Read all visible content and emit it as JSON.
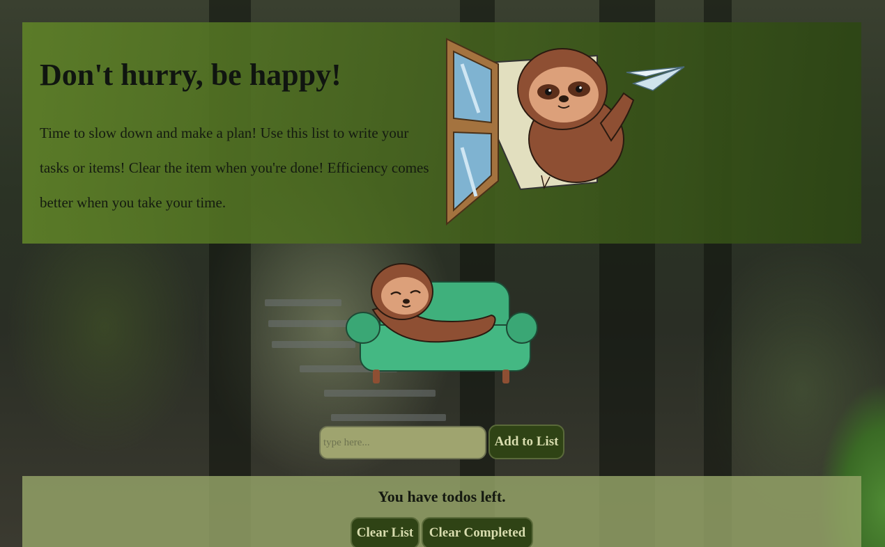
{
  "hero": {
    "title": "Don't hurry, be happy!",
    "description": "Time to slow down and make a plan! Use this list to write your tasks or items! Clear the item when you're done! Efficiency comes better when you take your time."
  },
  "todo_form": {
    "input_placeholder": "type here...",
    "input_value": "",
    "add_label": "Add to List"
  },
  "todo_list": {
    "count_text": "You have todos left.",
    "clear_list_label": "Clear List",
    "clear_completed_label": "Clear Completed"
  },
  "colors": {
    "hero_panel": "#5f8228",
    "list_panel": "#96a569",
    "button_bg": "#2f4315",
    "button_text": "#d8dcae",
    "input_bg": "#9fa46f"
  }
}
